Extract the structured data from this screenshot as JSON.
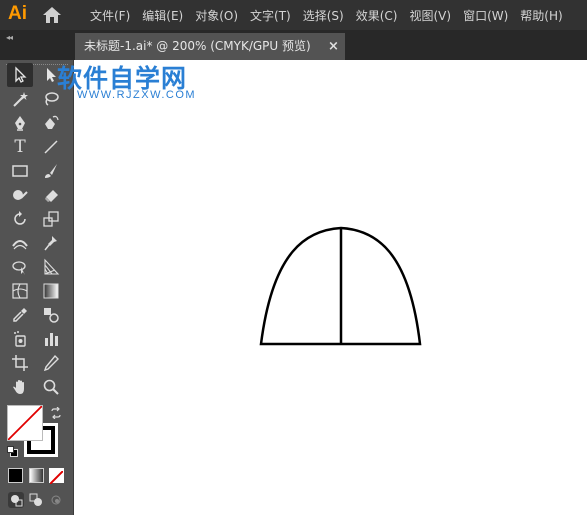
{
  "app": {
    "logo": "Ai"
  },
  "menu": [
    "文件(F)",
    "编辑(E)",
    "对象(O)",
    "文字(T)",
    "选择(S)",
    "效果(C)",
    "视图(V)",
    "窗口(W)",
    "帮助(H)"
  ],
  "tab": {
    "title": "未标题-1.ai* @ 200% (CMYK/GPU 预览)",
    "close": "×",
    "collapse": "◂◂"
  },
  "watermark": {
    "title": "软件自学网",
    "url": "WWW.RJZXW.COM"
  },
  "colors": {
    "watermark": "#2a7fd4",
    "logo": "#ff9a00",
    "stroke": "#000000",
    "fill_none_slash": "#e00000"
  },
  "tools": [
    "selection-tool",
    "direct-selection-tool",
    "magic-wand-tool",
    "lasso-tool",
    "pen-tool",
    "curvature-tool",
    "type-tool",
    "line-segment-tool",
    "rectangle-tool",
    "paintbrush-tool",
    "shaper-tool",
    "eraser-tool",
    "rotate-tool",
    "scale-tool",
    "width-tool",
    "puppet-warp-tool",
    "shape-builder-tool",
    "perspective-grid-tool",
    "mesh-tool",
    "gradient-tool",
    "eyedropper-tool",
    "blend-tool",
    "symbol-sprayer-tool",
    "column-graph-tool",
    "artboard-tool",
    "slice-tool",
    "hand-tool",
    "zoom-tool"
  ],
  "type_tool_glyph": "T"
}
